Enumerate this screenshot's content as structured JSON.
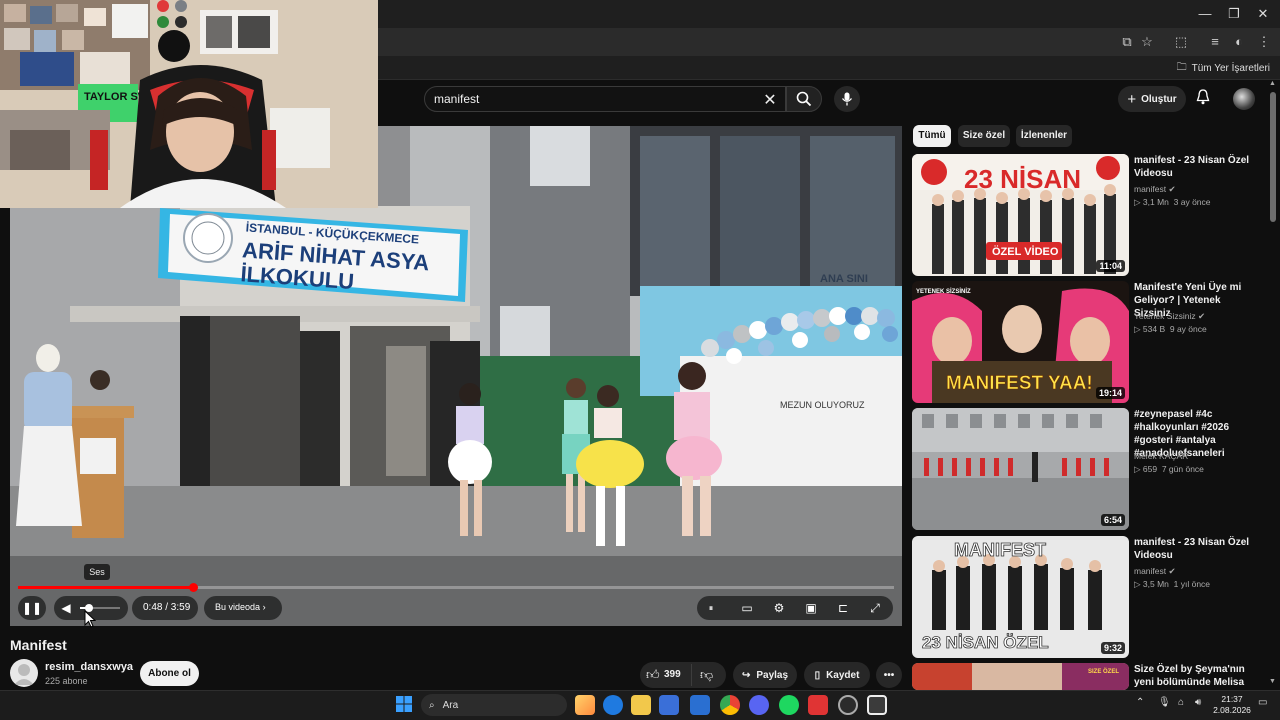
{
  "browser": {
    "bookmarks_all_label": "Tüm Yer İşaretleri"
  },
  "header": {
    "search_value": "manifest",
    "create_label": "Oluştur"
  },
  "webcam": {
    "poster_text": "TAYLOR SWIFT"
  },
  "player": {
    "sign_line1": "İSTANBUL - KÜÇÜKÇEKMECE",
    "sign_line2": "ARİF NİHAT ASYA",
    "sign_line3": "İLKOKULU",
    "banner_text": "MEZUN OLUYORUZ",
    "ana_sinif_text": "ANA SINI",
    "tooltip": "Ses",
    "time_display": "0:48 / 3:59",
    "chapter_label": "Bu videoda",
    "progress": 0.2
  },
  "video": {
    "title": "Manifest",
    "channel_name": "resim_dansxwya",
    "subscribers": "225 abone",
    "subscribe_label": "Abone ol",
    "likes": "399",
    "share_label": "Paylaş",
    "save_label": "Kaydet"
  },
  "sidebar": {
    "chips": [
      "Tümü",
      "Size özel",
      "İzlenenler"
    ],
    "recommendations": [
      {
        "title": "manifest - 23 Nisan Özel Videosu",
        "channel": "manifest",
        "verified": true,
        "views": "3,1 Mn",
        "age": "3 ay önce",
        "duration": "11:04",
        "thumb_text": "23 NİSAN",
        "thumb_sub": "ÖZEL VİDEO"
      },
      {
        "title": "Manifest'e Yeni Üye mi Geliyor? | Yetenek Sizsiniz",
        "channel": "Yetenek Sizsiniz",
        "verified": true,
        "views": "534 B",
        "age": "9 ay önce",
        "duration": "19:14",
        "thumb_text": "MANIFEST YAA!",
        "thumb_sub": "YETENEK SİZSİNİZ"
      },
      {
        "title": "#zeynepasel #4c #halkoyunları #2026 #gosteri #antalya #anadoluefsaneleri",
        "channel": "Melek KAÇAR",
        "verified": false,
        "views": "659",
        "age": "7 gün önce",
        "duration": "6:54"
      },
      {
        "title": "manifest - 23 Nisan Özel Videosu",
        "channel": "manifest",
        "verified": true,
        "views": "3,5 Mn",
        "age": "1 yıl önce",
        "duration": "9:32",
        "thumb_text": "MANIFEST",
        "thumb_sub": "23 NİSAN ÖZEL"
      },
      {
        "title": "Size Özel by Şeyma'nın yeni bölümünde Melisa Ilıcalı'nın",
        "thumb_text": "SIZE ÖZEL"
      }
    ]
  },
  "taskbar": {
    "search_placeholder": "Ara",
    "time": "21:37",
    "date": "2.08.2026"
  }
}
